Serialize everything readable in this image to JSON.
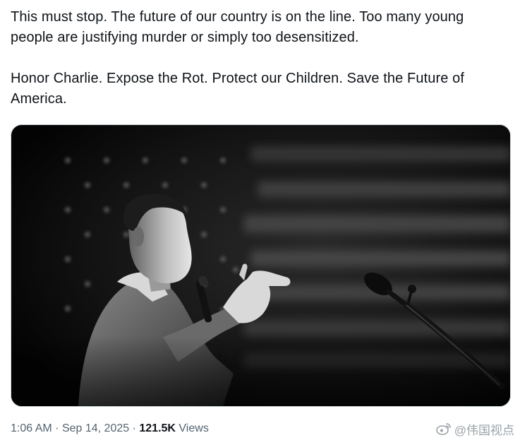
{
  "tweet": {
    "paragraph_1": "This must stop. The future of our country is on the line. Too many young people are justifying murder or simply too desensitized.",
    "paragraph_2": "Honor Charlie. Expose the Rot. Protect our Children. Save the Future of America."
  },
  "media": {
    "icon": "photo-speaker-at-podium-flag-background"
  },
  "meta": {
    "time": "1:06 AM",
    "separator_1": "·",
    "date": "Sep 14, 2025",
    "separator_2": "·",
    "views_count": "121.5K",
    "views_label": "Views"
  },
  "watermark": {
    "text": "@伟国视点",
    "icon": "weibo-icon"
  },
  "colors": {
    "text": "#0f1419",
    "secondary_text": "#536471",
    "media_border": "#cfd9de"
  }
}
